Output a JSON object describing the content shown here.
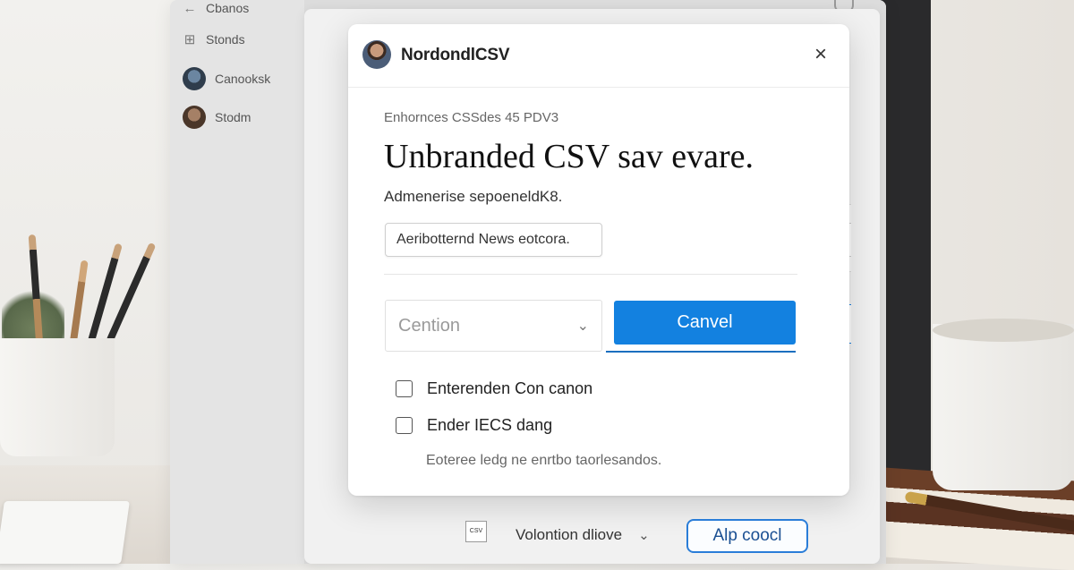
{
  "app": {
    "back_label": "Cbanos",
    "sidebar": {
      "items": [
        {
          "label": "Stonds",
          "icon": "grid-icon"
        },
        {
          "label": "Canooksk",
          "icon": "avatar"
        },
        {
          "label": "Stodm",
          "icon": "avatar"
        }
      ]
    }
  },
  "dialog": {
    "title": "NordondlCSV",
    "close_icon": "×",
    "eyebrow": "Enhornces CSSdes 45 PDV3",
    "heading": "Unbranded CSV sav evare.",
    "subtitle": "Admenerise sepoeneldK8.",
    "input_value": "Aeribotternd News eotcora.",
    "select": {
      "value": "Cention",
      "chevron": "⌄"
    },
    "primary_button": "Canvel",
    "checkboxes": [
      {
        "label": "Enterenden Con canon",
        "checked": false
      },
      {
        "label": "Ender IECS dang",
        "checked": false
      }
    ],
    "footnote": "Eoteree ledg ne enrtbo taorlesandos."
  },
  "side_stub": {
    "label": ">"
  },
  "bottom_bar": {
    "file_badge": "CSV",
    "select_value": "Volontion dliove",
    "select_chevron": "⌄",
    "button_label": "Alp coocl"
  },
  "colors": {
    "primary": "#1381e0",
    "outline_button": "#2a7dd8"
  }
}
